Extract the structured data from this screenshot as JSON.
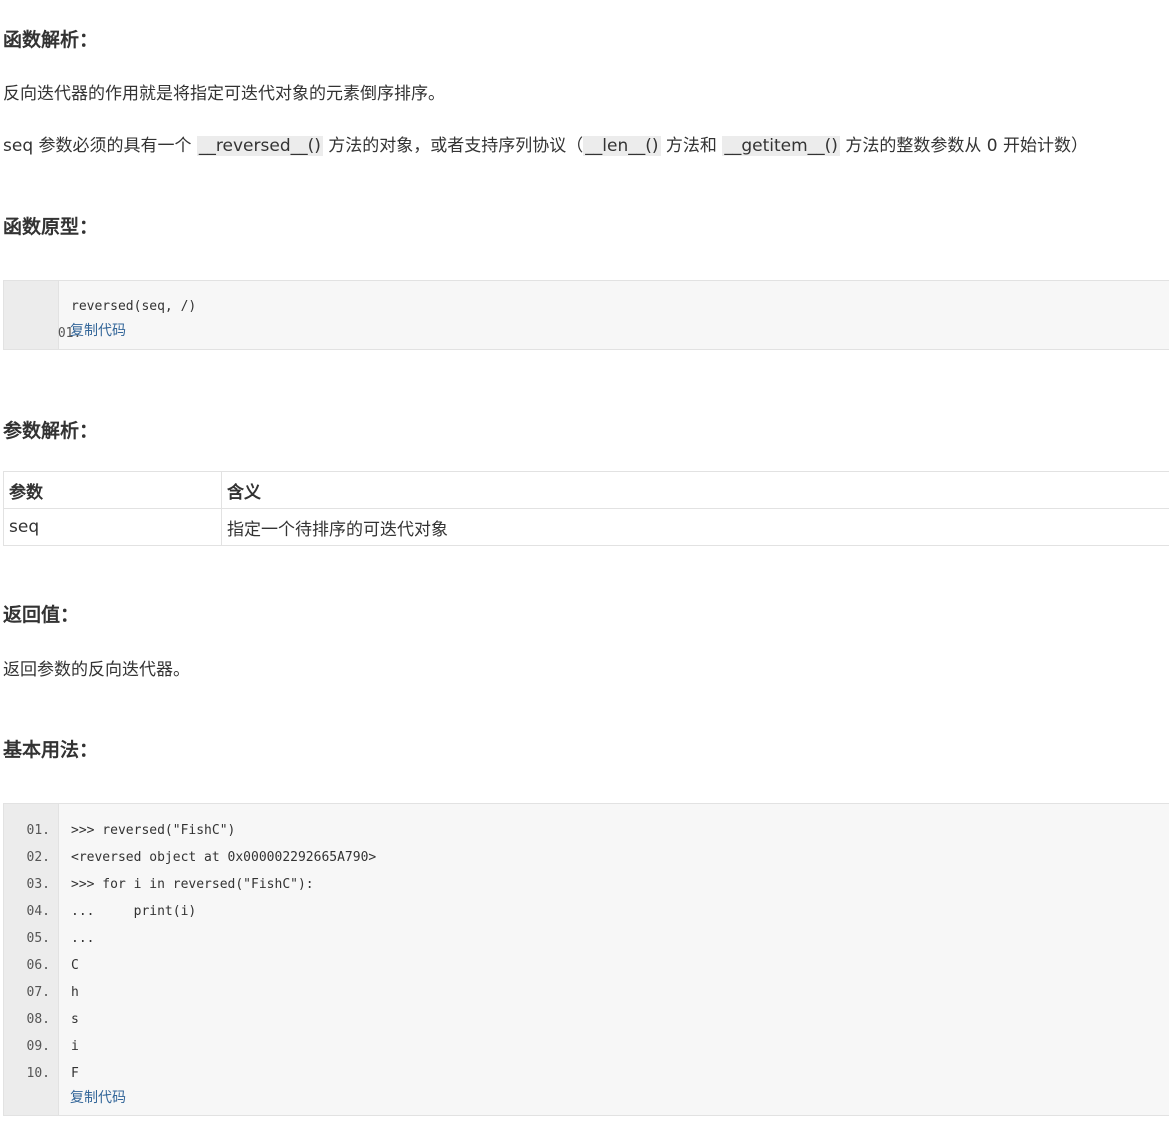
{
  "sections": {
    "analysis_heading": "函数解析：",
    "analysis_p1": "反向迭代器的作用就是将指定可迭代对象的元素倒序排序。",
    "analysis_p2": {
      "t1": "seq 参数必须的具有一个 ",
      "c1": "__reversed__()",
      "t2": " 方法的对象，或者支持序列协议（",
      "c2": "__len__()",
      "t3": " 方法和 ",
      "c3": "__getitem__()",
      "t4": " 方法的整数参数从 0 开始计数）"
    },
    "prototype_heading": "函数原型：",
    "params_heading": "参数解析：",
    "return_heading": "返回值：",
    "return_text": "返回参数的反向迭代器。",
    "usage_heading": "基本用法："
  },
  "prototype_code": {
    "lines": [
      {
        "num": "01.",
        "code": "reversed(seq, /)"
      }
    ],
    "copy_label": "复制代码"
  },
  "params_table": {
    "headers": [
      "参数",
      "含义"
    ],
    "rows": [
      [
        "seq",
        "指定一个待排序的可迭代对象"
      ]
    ]
  },
  "usage_code": {
    "lines": [
      {
        "num": "01.",
        "code": ">>> reversed(\"FishC\")"
      },
      {
        "num": "02.",
        "code": "<reversed object at 0x000002292665A790>"
      },
      {
        "num": "03.",
        "code": ">>> for i in reversed(\"FishC\"):"
      },
      {
        "num": "04.",
        "code": "...     print(i)"
      },
      {
        "num": "05.",
        "code": "..."
      },
      {
        "num": "06.",
        "code": "C"
      },
      {
        "num": "07.",
        "code": "h"
      },
      {
        "num": "08.",
        "code": "s"
      },
      {
        "num": "09.",
        "code": "i"
      },
      {
        "num": "10.",
        "code": "F"
      }
    ],
    "copy_label": "复制代码"
  }
}
